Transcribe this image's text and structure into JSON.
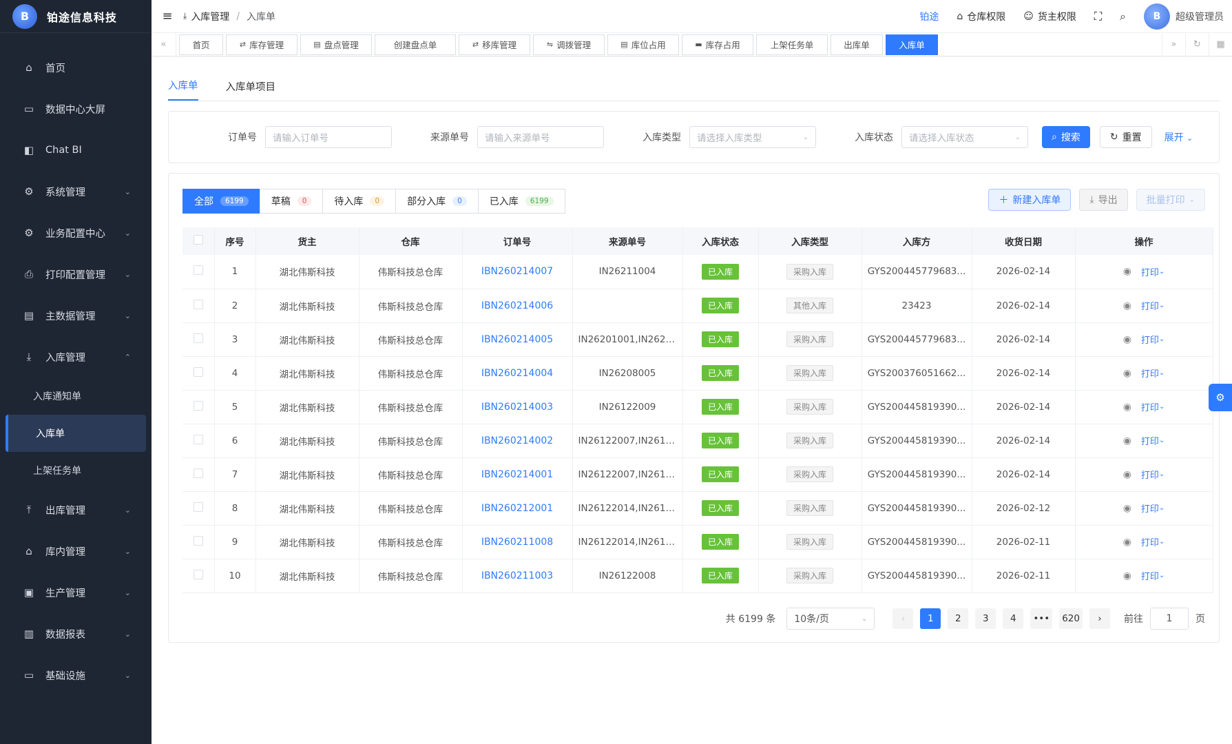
{
  "brand": {
    "name": "铂途信息科技",
    "mark": "B"
  },
  "sidebar": {
    "items": [
      {
        "label": "首页",
        "icon": "home-icon",
        "glyph": "⌂"
      },
      {
        "label": "数据中心大屏",
        "icon": "monitor-icon",
        "glyph": "▭"
      },
      {
        "label": "Chat BI",
        "icon": "chat-icon",
        "glyph": "◧"
      },
      {
        "label": "系统管理",
        "icon": "gear-icon",
        "glyph": "⚙"
      },
      {
        "label": "业务配置中心",
        "icon": "settings-icon",
        "glyph": "⚙"
      },
      {
        "label": "打印配置管理",
        "icon": "printer-icon",
        "glyph": "⎙"
      },
      {
        "label": "主数据管理",
        "icon": "database-icon",
        "glyph": "▤"
      },
      {
        "label": "入库管理",
        "icon": "download-icon",
        "glyph": "⤓"
      },
      {
        "label": "出库管理",
        "icon": "upload-icon",
        "glyph": "⤒"
      },
      {
        "label": "库内管理",
        "icon": "warehouse-icon",
        "glyph": "⌂"
      },
      {
        "label": "生产管理",
        "icon": "toolbox-icon",
        "glyph": "▣"
      },
      {
        "label": "数据报表",
        "icon": "chart-icon",
        "glyph": "▥"
      },
      {
        "label": "基础设施",
        "icon": "desktop-icon",
        "glyph": "▭"
      }
    ],
    "sub": [
      "入库通知单",
      "入库单",
      "上架任务单"
    ]
  },
  "header": {
    "crumb1": "入库管理",
    "crumb2": "入库单",
    "link": "铂途",
    "perm1": "仓库权限",
    "perm2": "货主权限",
    "user": "超级管理员"
  },
  "tabs": [
    "首页",
    "库存管理",
    "盘点管理",
    "创建盘点单",
    "移库管理",
    "调拨管理",
    "库位占用",
    "库存占用",
    "上架任务单",
    "出库单",
    "入库单"
  ],
  "page_tabs": [
    "入库单",
    "入库单项目"
  ],
  "filter": {
    "order_label": "订单号",
    "order_ph": "请输入订单号",
    "source_label": "来源单号",
    "source_ph": "请输入来源单号",
    "type_label": "入库类型",
    "type_ph": "请选择入库类型",
    "status_label": "入库状态",
    "status_ph": "请选择入库状态",
    "search": "搜索",
    "reset": "重置",
    "expand": "展开"
  },
  "stats": [
    {
      "label": "全部",
      "count": "6199"
    },
    {
      "label": "草稿",
      "count": "0"
    },
    {
      "label": "待入库",
      "count": "0"
    },
    {
      "label": "部分入库",
      "count": "0"
    },
    {
      "label": "已入库",
      "count": "6199"
    }
  ],
  "actions": {
    "new": "新建入库单",
    "export": "导出",
    "batch_print": "批量打印"
  },
  "columns": [
    "序号",
    "货主",
    "仓库",
    "订单号",
    "来源单号",
    "入库状态",
    "入库类型",
    "入库方",
    "收货日期",
    "操作"
  ],
  "rows": [
    [
      "1",
      "湖北伟斯科技",
      "伟斯科技总仓库",
      "IBN260214007",
      "IN26211004",
      "已入库",
      "采购入库",
      "GYS200445779683...",
      "2026-02-14"
    ],
    [
      "2",
      "湖北伟斯科技",
      "伟斯科技总仓库",
      "IBN260214006",
      "",
      "已入库",
      "其他入库",
      "23423",
      "2026-02-14"
    ],
    [
      "3",
      "湖北伟斯科技",
      "伟斯科技总仓库",
      "IBN260214005",
      "IN26201001,IN2620...",
      "已入库",
      "采购入库",
      "GYS200445779683...",
      "2026-02-14"
    ],
    [
      "4",
      "湖北伟斯科技",
      "伟斯科技总仓库",
      "IBN260214004",
      "IN26208005",
      "已入库",
      "采购入库",
      "GYS200376051662...",
      "2026-02-14"
    ],
    [
      "5",
      "湖北伟斯科技",
      "伟斯科技总仓库",
      "IBN260214003",
      "IN26122009",
      "已入库",
      "采购入库",
      "GYS200445819390...",
      "2026-02-14"
    ],
    [
      "6",
      "湖北伟斯科技",
      "伟斯科技总仓库",
      "IBN260214002",
      "IN26122007,IN2612...",
      "已入库",
      "采购入库",
      "GYS200445819390...",
      "2026-02-14"
    ],
    [
      "7",
      "湖北伟斯科技",
      "伟斯科技总仓库",
      "IBN260214001",
      "IN26122007,IN2612...",
      "已入库",
      "采购入库",
      "GYS200445819390...",
      "2026-02-14"
    ],
    [
      "8",
      "湖北伟斯科技",
      "伟斯科技总仓库",
      "IBN260212001",
      "IN26122014,IN2612...",
      "已入库",
      "采购入库",
      "GYS200445819390...",
      "2026-02-12"
    ],
    [
      "9",
      "湖北伟斯科技",
      "伟斯科技总仓库",
      "IBN260211008",
      "IN26122014,IN2612...",
      "已入库",
      "采购入库",
      "GYS200445819390...",
      "2026-02-11"
    ],
    [
      "10",
      "湖北伟斯科技",
      "伟斯科技总仓库",
      "IBN260211003",
      "IN26122008",
      "已入库",
      "采购入库",
      "GYS200445819390...",
      "2026-02-11"
    ]
  ],
  "row_action": "打印",
  "pager": {
    "total": "共 6199 条",
    "size": "10条/页",
    "pages": [
      "1",
      "2",
      "3",
      "4",
      "•••",
      "620"
    ],
    "goto": "前往",
    "goto_val": "1",
    "page_unit": "页"
  }
}
